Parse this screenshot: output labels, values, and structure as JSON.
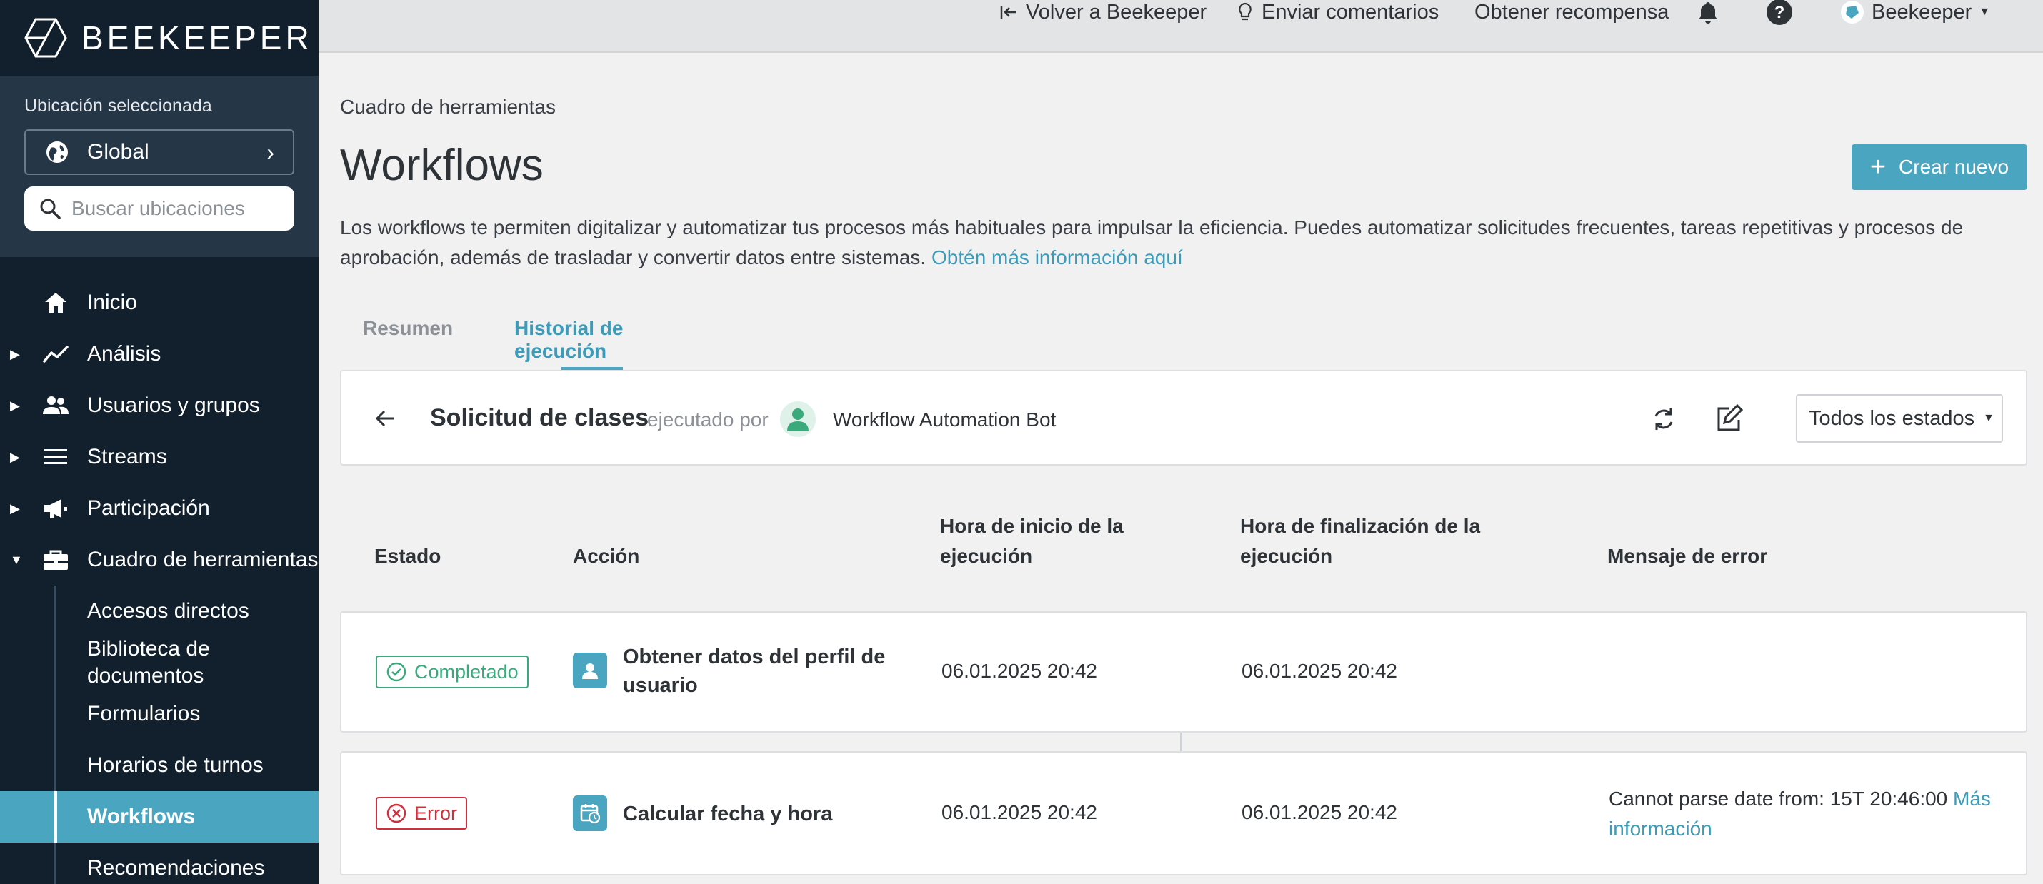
{
  "sidebar": {
    "brand": "BEEKEEPER",
    "location_label": "Ubicación seleccionada",
    "location_value": "Global",
    "search_placeholder": "Buscar ubicaciones",
    "items": [
      {
        "label": "Inicio",
        "icon": "home-icon"
      },
      {
        "label": "Análisis",
        "icon": "analytics-icon"
      },
      {
        "label": "Usuarios y grupos",
        "icon": "users-icon"
      },
      {
        "label": "Streams",
        "icon": "streams-icon"
      },
      {
        "label": "Participación",
        "icon": "megaphone-icon"
      },
      {
        "label": "Cuadro de herramientas",
        "icon": "toolbox-icon"
      }
    ],
    "subitems": [
      "Accesos directos",
      "Biblioteca de documentos",
      "Formularios",
      "Horarios de turnos",
      "Workflows",
      "Recomendaciones"
    ],
    "active_subitem": "Workflows"
  },
  "topbar": {
    "back": "Volver a Beekeeper",
    "feedback": "Enviar comentarios",
    "reward": "Obtener recompensa",
    "account": "Beekeeper"
  },
  "main": {
    "breadcrumb": "Cuadro de herramientas",
    "title": "Workflows",
    "create_button": "Crear nuevo",
    "description": "Los workflows te permiten digitalizar y automatizar tus procesos más habituales para impulsar la eficiencia. Puedes automatizar solicitudes frecuentes, tareas repetitivas y procesos de aprobación, además de trasladar y convertir datos entre sistemas.",
    "description_link": "Obtén más información aquí",
    "tabs": [
      "Resumen",
      "Historial de ejecución"
    ],
    "active_tab": "Historial de ejecución"
  },
  "run": {
    "name": "Solicitud de clases",
    "executed_by_label": "ejecutado por",
    "executor": "Workflow Automation Bot",
    "status_filter": "Todos los estados"
  },
  "table": {
    "headers": [
      "Estado",
      "Acción",
      "Hora de inicio de la ejecución",
      "Hora de finalización de la ejecución",
      "Mensaje de error"
    ],
    "rows": [
      {
        "status": "Completado",
        "status_color": "#3aaa7c",
        "action": "Obtener datos del perfil de usuario",
        "action_icon": "user-profile-icon",
        "start": "06.01.2025 20:42",
        "end": "06.01.2025 20:42",
        "error": "",
        "error_link": ""
      },
      {
        "status": "Error",
        "status_color": "#d0303e",
        "action": "Calcular fecha y hora",
        "action_icon": "calendar-clock-icon",
        "start": "06.01.2025 20:42",
        "end": "06.01.2025 20:42",
        "error": "Cannot parse date from: 15T 20:46:00",
        "error_link": "Más información"
      }
    ]
  },
  "colors": {
    "sidebar_bg": "#12202e",
    "accent": "#4aa6c0",
    "success": "#3aaa7c",
    "error": "#d0303e"
  }
}
